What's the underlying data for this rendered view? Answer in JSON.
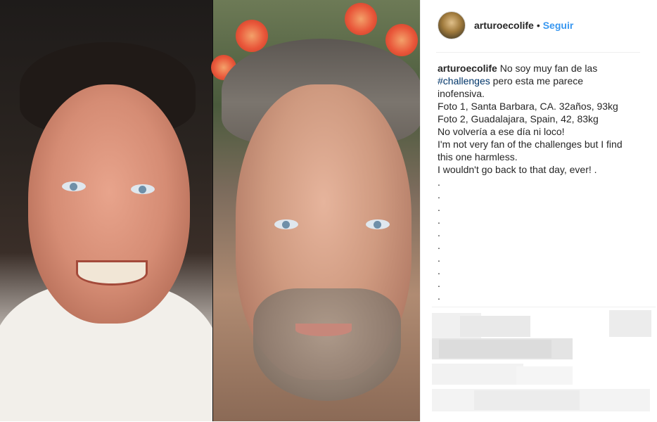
{
  "post": {
    "username": "arturoecolife",
    "follow_label": "Seguir",
    "separator": "•",
    "caption": {
      "user": "arturoecolife",
      "text_before_tag": " No soy muy fan de las",
      "hashtag": "#challenges",
      "text_after_tag": " pero esta me parece",
      "lines": [
        "inofensiva.",
        "Foto 1, Santa Barbara, CA. 32años, 93kg",
        "Foto 2, Guadalajara, Spain, 42, 83kg",
        "No volvería a ese día ni loco!",
        "I'm not very fan of the challenges but I find",
        "this one harmless.",
        "I wouldn't go back to that day, ever! ."
      ],
      "dots": [
        ".",
        ".",
        ".",
        ".",
        ".",
        ".",
        ".",
        ".",
        ".",
        "."
      ]
    }
  },
  "icons": {
    "avatar": "avatar-photo"
  },
  "colors": {
    "follow_blue": "#3897f0",
    "hashtag": "#003569",
    "text": "#262626"
  }
}
